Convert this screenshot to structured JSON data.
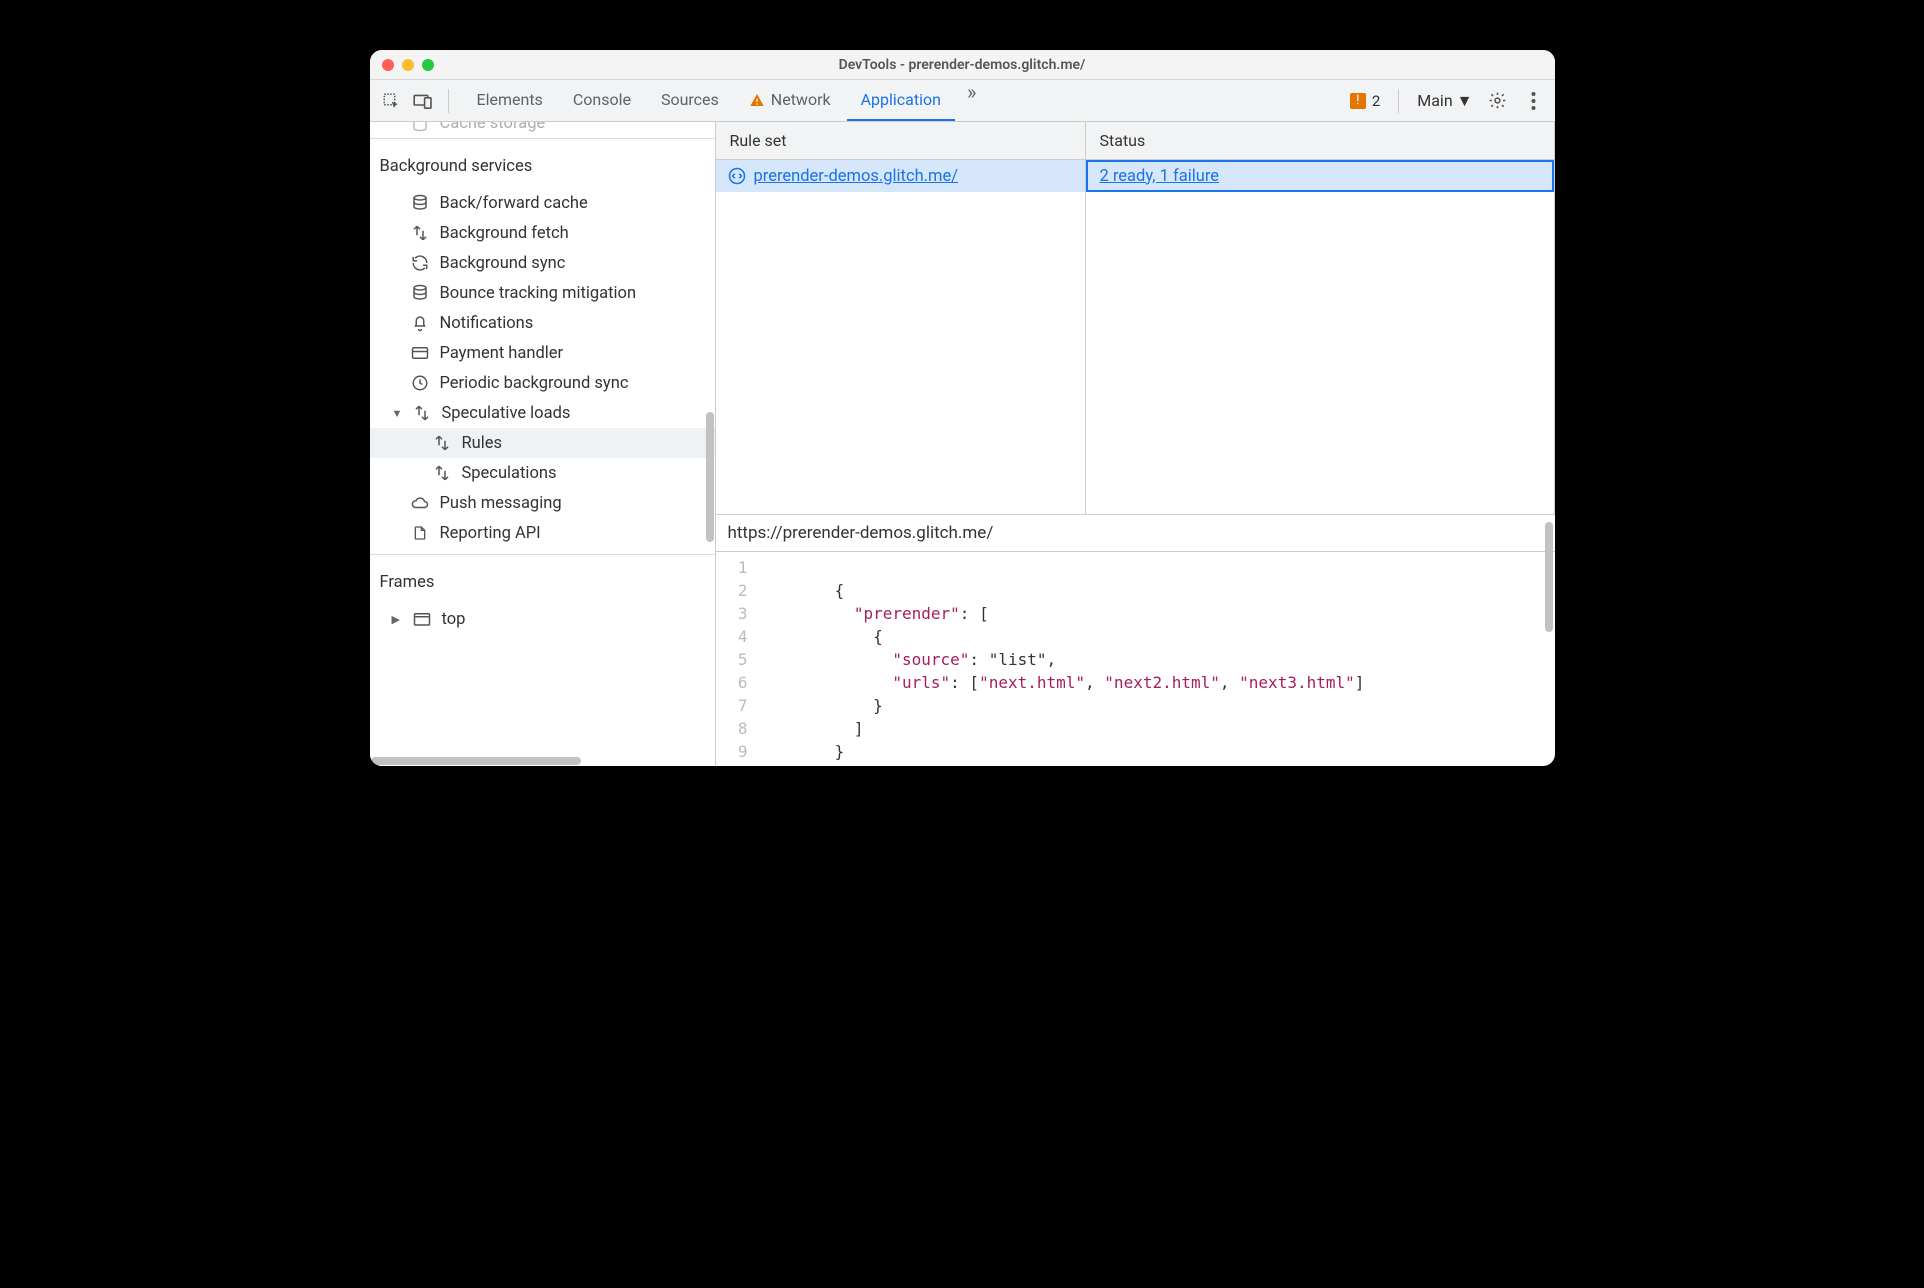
{
  "window": {
    "title": "DevTools - prerender-demos.glitch.me/"
  },
  "toolbar": {
    "tabs": {
      "elements": "Elements",
      "console": "Console",
      "sources": "Sources",
      "network": "Network",
      "application": "Application"
    },
    "issues_count": "2",
    "target_label": "Main"
  },
  "sidebar": {
    "truncated_first": "Cache storage",
    "bg_title": "Background services",
    "bg_items": [
      "Back/forward cache",
      "Background fetch",
      "Background sync",
      "Bounce tracking mitigation",
      "Notifications",
      "Payment handler",
      "Periodic background sync"
    ],
    "spec_parent": "Speculative loads",
    "spec_children": [
      "Rules",
      "Speculations"
    ],
    "bg_items_tail": [
      "Push messaging",
      "Reporting API"
    ],
    "frames_title": "Frames",
    "frames_top": "top"
  },
  "rules": {
    "header_ruleset": "Rule set",
    "header_status": "Status",
    "row_url": "prerender-demos.glitch.me/",
    "row_status": "2 ready,  1 failure"
  },
  "source": {
    "url": "https://prerender-demos.glitch.me/",
    "lines": [
      "",
      "        {",
      "          \"prerender\": [",
      "            {",
      "              \"source\": \"list\",",
      "              \"urls\": [\"next.html\", \"next2.html\", \"next3.html\"]",
      "            }",
      "          ]",
      "        }"
    ]
  }
}
